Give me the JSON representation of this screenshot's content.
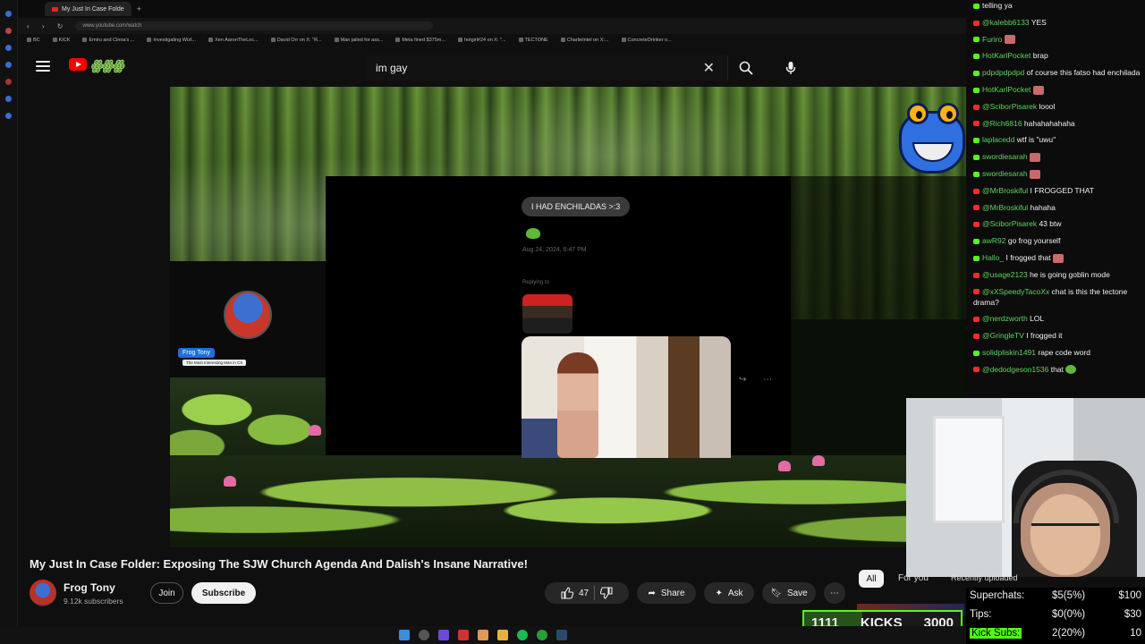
{
  "browser": {
    "active_tab": "My Just In Case Folde",
    "url": "www.youtube.com/watch",
    "bookmarks": [
      "BC",
      "KICK",
      "Emiru and Cinna's ...",
      "Investigating Wizt...",
      "Xen AaronTheLoc...",
      "David Orr on X: \"R...",
      "Man jailed for ass...",
      "Meta fined $375m...",
      "hotgirl#24 on X: \"...",
      "TECTONE",
      "CharlieIntel on X:...",
      "ConcreteDrinker o..."
    ]
  },
  "header": {
    "search_value": "im gay",
    "logo_text": "ꙮꙮꙮ"
  },
  "video": {
    "message_text": "I HAD ENCHILADAS >:3",
    "message_timestamp": "Aug 24, 2024, 6:47 PM",
    "reply_label": "Replying to",
    "name_tag": "Frog Tony",
    "name_tag_sub": "The Most Interesting Man in CS"
  },
  "meta": {
    "title": "My Just In Case Folder: Exposing The SJW Church Agenda And Dalish's Insane Narrative!",
    "channel_name": "Frog Tony",
    "subscribers": "9.12k subscribers",
    "join_label": "Join",
    "subscribe_label": "Subscribe",
    "likes": "47",
    "share_label": "Share",
    "ask_label": "Ask",
    "save_label": "Save",
    "more_label": "⋯"
  },
  "filters": {
    "all": "All",
    "for_you": "For you",
    "recent": "Recently uploaded"
  },
  "chat": {
    "messages": [
      {
        "platform": "kick",
        "user": "",
        "text": "telling ya"
      },
      {
        "platform": "yt",
        "user": "@kalebb6133",
        "text": "YES"
      },
      {
        "platform": "kick",
        "user": "Furiro",
        "text": "",
        "emote": true
      },
      {
        "platform": "kick",
        "user": "HotKarlPocket",
        "text": "brap"
      },
      {
        "platform": "kick",
        "user": "pdpdpdpdpd",
        "text": "of course this fatso had enchilada"
      },
      {
        "platform": "kick",
        "user": "HotKarlPocket",
        "text": "",
        "emote": true
      },
      {
        "platform": "yt",
        "user": "@SciborPisarek",
        "text": "loool"
      },
      {
        "platform": "yt",
        "user": "@Rich6816",
        "text": "hahahahahaha"
      },
      {
        "platform": "kick",
        "user": "laplacedd",
        "text": "wtf is \"uwu\""
      },
      {
        "platform": "kick",
        "user": "swordiesarah",
        "text": "",
        "emote": true
      },
      {
        "platform": "kick",
        "user": "swordiesarah",
        "text": "",
        "emote": true
      },
      {
        "platform": "yt",
        "user": "@MrBroskiful",
        "text": "I FROGGED THAT"
      },
      {
        "platform": "yt",
        "user": "@MrBroskiful",
        "text": "hahaha"
      },
      {
        "platform": "yt",
        "user": "@SciborPisarek",
        "text": "43 btw"
      },
      {
        "platform": "kick",
        "user": "awR92",
        "text": "go frog yourself"
      },
      {
        "platform": "kick",
        "user": "Hallo_",
        "text": "I frogged that",
        "emote": true
      },
      {
        "platform": "yt",
        "user": "@usage2123",
        "text": "he is going goblin mode"
      },
      {
        "platform": "yt",
        "user": "@xXSpeedyTacoXx",
        "text": "chat is this the tectone drama?"
      },
      {
        "platform": "yt",
        "user": "@nerdzworth",
        "text": "LOL"
      },
      {
        "platform": "yt",
        "user": "@GringleTV",
        "text": "I frogged it"
      },
      {
        "platform": "kick",
        "user": "solidpliskin1491",
        "text": "rape code word"
      },
      {
        "platform": "yt",
        "user": "@dedodgeson1536",
        "text": "that",
        "emote": true
      }
    ]
  },
  "stats": {
    "superchats_label": "Superchats:",
    "superchats_value": "$5(5%)",
    "superchats_goal": "$100",
    "tips_label": "Tips:",
    "tips_value": "$0(0%)",
    "tips_goal": "$30",
    "kicksubs_label": "Kick Subs:",
    "kicksubs_value": "2(20%)",
    "kicksubs_goal": "10",
    "kicks_current": "1111",
    "kicks_label": "KICKS",
    "kicks_goal": "3000",
    "kicks_fraction": 0.37
  },
  "colors": {
    "kick_green": "#53fc18",
    "yt_red": "#ff0000",
    "bg": "#0f0f0f"
  }
}
